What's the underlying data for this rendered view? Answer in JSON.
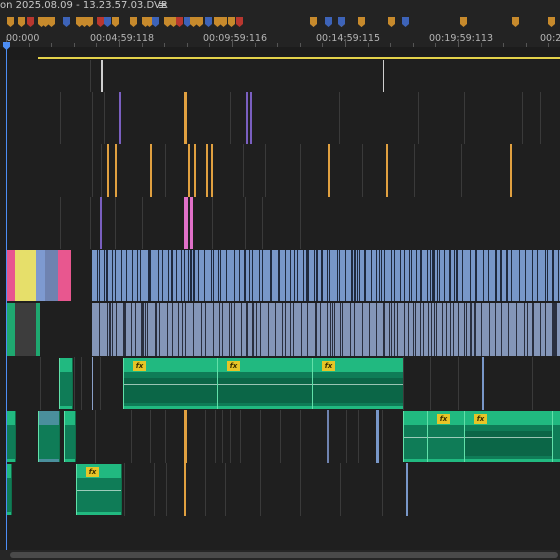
{
  "title_bar": {
    "sequence_title": "on 2025.08.09 - 13.23.57.03.DVR",
    "menu_icon": "≡"
  },
  "ruler": {
    "timecodes": [
      "00:000",
      "00:04:59:118",
      "00:09:59:116",
      "00:14:59:115",
      "00:19:59:113",
      "00:2"
    ]
  },
  "colors": {
    "background": "#1c1c1c",
    "track": "#1f1f1f",
    "playhead": "#4d8ef5",
    "work_area": "#e3d14a",
    "audio_clip": "#21b980",
    "video_clip": "#7897c8",
    "fx_badge": "#e7c527",
    "marker_orange": "#c78a2c",
    "marker_blue": "#3d63b8",
    "marker_red": "#b8372f"
  },
  "markers": {
    "colors": [
      "orange",
      "orange",
      "red",
      "orange",
      "orange",
      "orange",
      "blue",
      "orange",
      "orange",
      "orange",
      "red",
      "blue",
      "orange",
      "orange",
      "orange",
      "orange",
      "blue",
      "orange",
      "orange",
      "red",
      "blue",
      "orange",
      "orange",
      "blue",
      "orange",
      "orange",
      "orange",
      "red",
      "blue",
      "orange",
      "orange"
    ]
  },
  "tracks": {
    "names": [
      "video-track-6",
      "video-track-5",
      "video-track-4",
      "video-track-3",
      "video-track-2",
      "video-track-1",
      "audio-track-1",
      "audio-track-2",
      "audio-track-3"
    ],
    "fx_badge_label": "fx"
  }
}
